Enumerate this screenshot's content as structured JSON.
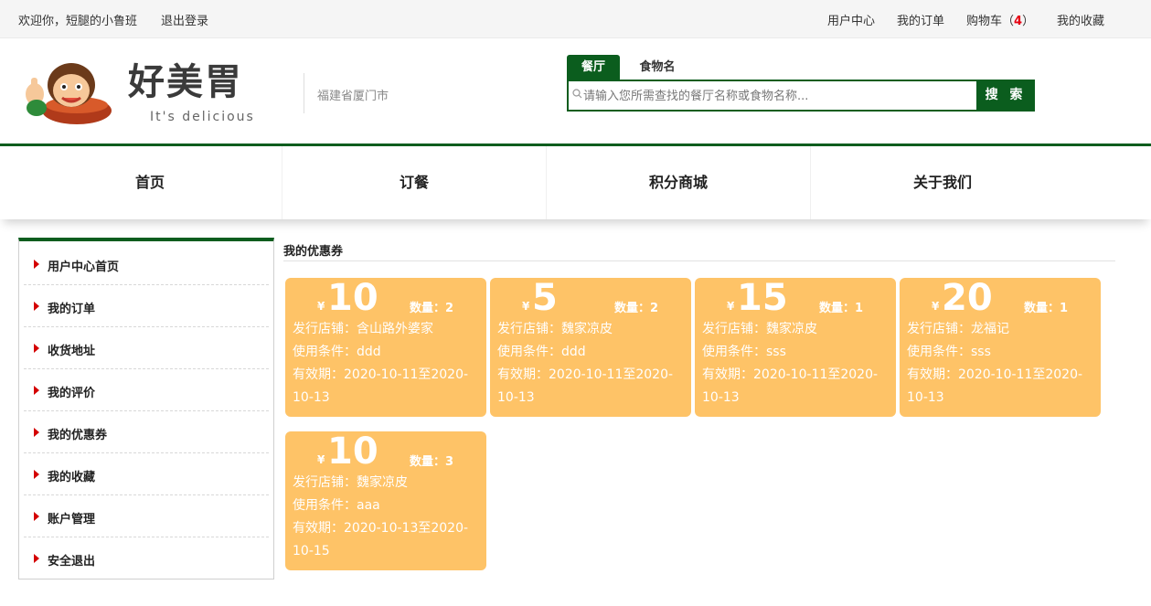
{
  "topbar": {
    "welcome": "欢迎你，短腿的小鲁班",
    "logout": "退出登录",
    "user_center": "用户中心",
    "my_orders": "我的订单",
    "cart_label": "购物车（",
    "cart_count": "4",
    "cart_close": "）",
    "favorites": "我的收藏"
  },
  "header": {
    "brand": "好美胃",
    "slogan": "It's delicious",
    "city": "福建省厦门市"
  },
  "search": {
    "tab_active": "餐厅",
    "tab_other": "食物名",
    "placeholder": "请输入您所需查找的餐厅名称或食物名称...",
    "button": "搜 索"
  },
  "nav": [
    "首页",
    "订餐",
    "积分商城",
    "关于我们"
  ],
  "sidebar": {
    "items": [
      "用户中心首页",
      "我的订单",
      "收货地址",
      "我的评价",
      "我的优惠券",
      "我的收藏",
      "账户管理",
      "安全退出"
    ]
  },
  "main": {
    "title": "我的优惠券",
    "coupons": [
      {
        "yen": "¥",
        "amount": "10",
        "qty": "数量：2",
        "shop": "发行店铺：含山路外婆家",
        "cond": "使用条件：ddd",
        "valid1": "有效期：2020-10-11至2020-",
        "valid2": "10-13"
      },
      {
        "yen": "¥",
        "amount": "5",
        "qty": "数量：2",
        "shop": "发行店铺：魏家凉皮",
        "cond": "使用条件：ddd",
        "valid1": "有效期：2020-10-11至2020-",
        "valid2": "10-13"
      },
      {
        "yen": "¥",
        "amount": "15",
        "qty": "数量：1",
        "shop": "发行店铺：魏家凉皮",
        "cond": "使用条件：sss",
        "valid1": "有效期：2020-10-11至2020-",
        "valid2": "10-13"
      },
      {
        "yen": "¥",
        "amount": "20",
        "qty": "数量：1",
        "shop": "发行店铺：龙福记",
        "cond": "使用条件：sss",
        "valid1": "有效期：2020-10-11至2020-",
        "valid2": "10-13"
      },
      {
        "yen": "¥",
        "amount": "10",
        "qty": "数量：3",
        "shop": "发行店铺：魏家凉皮",
        "cond": "使用条件：aaa",
        "valid1": "有效期：2020-10-13至2020-",
        "valid2": "10-15"
      }
    ]
  },
  "colors": {
    "brand_green": "#0b5d1e",
    "coupon_bg": "#fec367",
    "arrow_red": "#d40000",
    "cart_red": "#e60012"
  }
}
